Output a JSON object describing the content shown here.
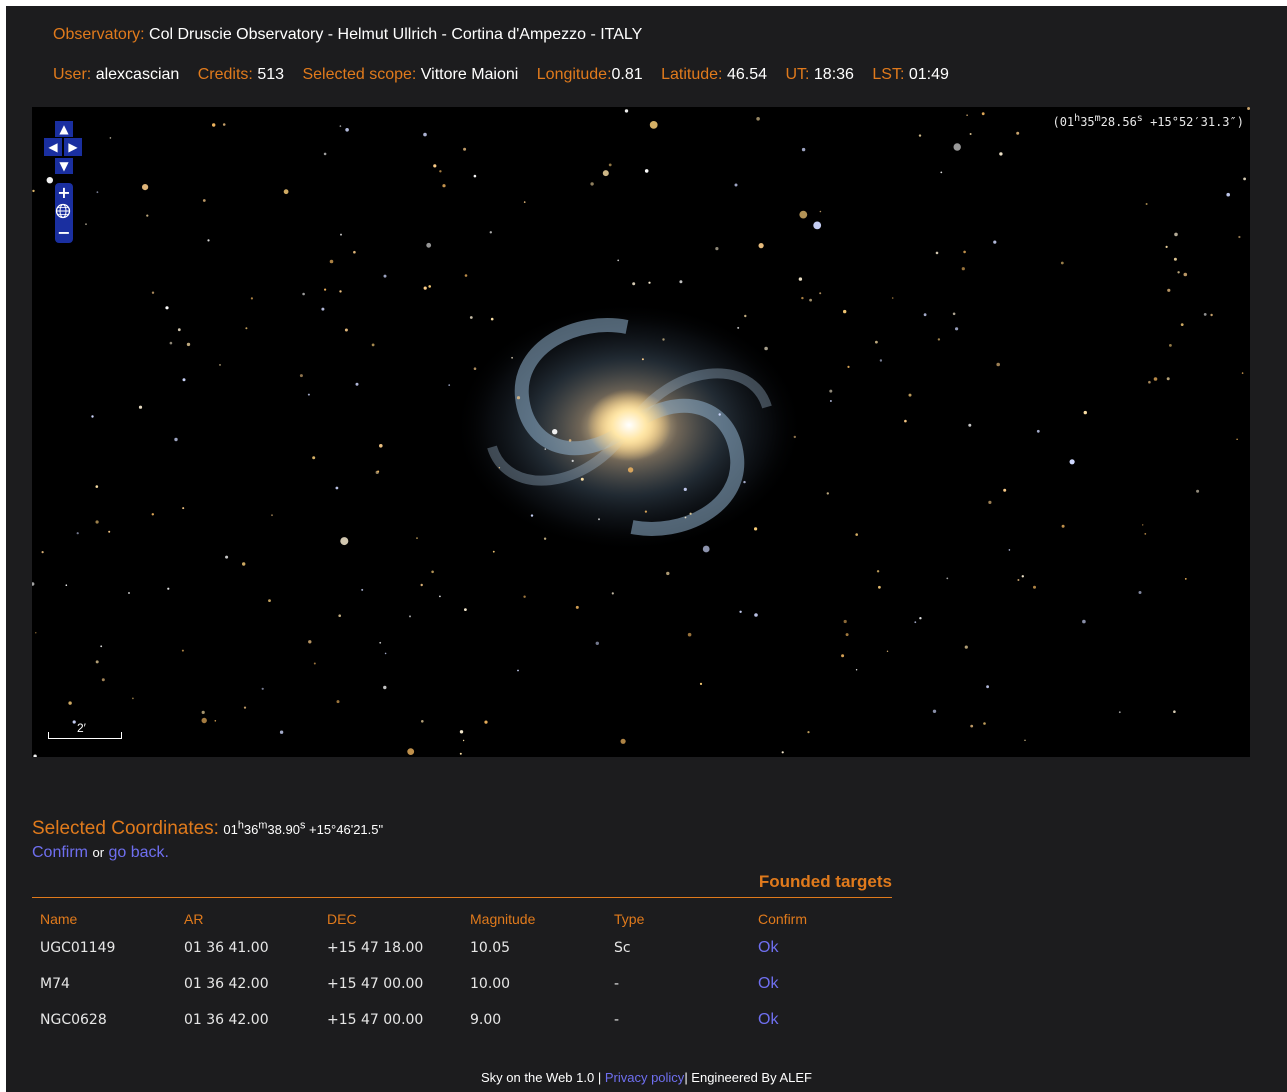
{
  "header": {
    "observatory_label": "Observatory:",
    "observatory_value": "Col Druscie Observatory - Helmut Ullrich - Cortina d'Ampezzo - ITALY",
    "user_label": "User:",
    "user_value": "alexcascian",
    "credits_label": "Credits:",
    "credits_value": "513",
    "scope_label": "Selected scope:",
    "scope_value": "Vittore Maioni",
    "longitude_label": "Longitude:",
    "longitude_value": "0.81",
    "latitude_label": "Latitude:",
    "latitude_value": "46.54",
    "ut_label": "UT:",
    "ut_value": "18:36",
    "lst_label": "LST:",
    "lst_value": "01:49"
  },
  "sky_view": {
    "coords": {
      "ra_h": "01",
      "ra_m": "35",
      "ra_s": "28.56",
      "dec": "+15°52′31.3″"
    },
    "scale_label": "2′",
    "controls": {
      "up": "▲",
      "left": "◀",
      "right": "▶",
      "down": "▼",
      "zoom_in": "+",
      "world": "🌐",
      "zoom_out": "−"
    }
  },
  "selection": {
    "label": "Selected Coordinates:",
    "ra_h": "01",
    "ra_m": "36",
    "ra_s": "38.90",
    "dec": "+15°46'21.5\"",
    "confirm_link": "Confirm",
    "or_text": "or",
    "back_link": "go back."
  },
  "targets": {
    "title": "Founded targets",
    "columns": [
      "Name",
      "AR",
      "DEC",
      "Magnitude",
      "Type",
      "Confirm"
    ],
    "rows": [
      {
        "name": "UGC01149",
        "ar": "01 36 41.00",
        "dec": "+15 47 18.00",
        "magnitude": "10.05",
        "type": "Sc",
        "confirm": "Ok"
      },
      {
        "name": "M74",
        "ar": "01 36 42.00",
        "dec": "+15 47 00.00",
        "magnitude": "10.00",
        "type": "-",
        "confirm": "Ok"
      },
      {
        "name": "NGC0628",
        "ar": "01 36 42.00",
        "dec": "+15 47 00.00",
        "magnitude": "9.00",
        "type": "-",
        "confirm": "Ok"
      }
    ]
  },
  "footer": {
    "prefix": "Sky on the Web 1.0 |",
    "privacy_link": "Privacy policy",
    "suffix": "| Engineered By ALEF"
  },
  "colors": {
    "background": "#1c1c1e",
    "label_orange": "#e07a1c",
    "link_blue": "#6f6ff0",
    "nav_blue": "#1a2fa0"
  }
}
